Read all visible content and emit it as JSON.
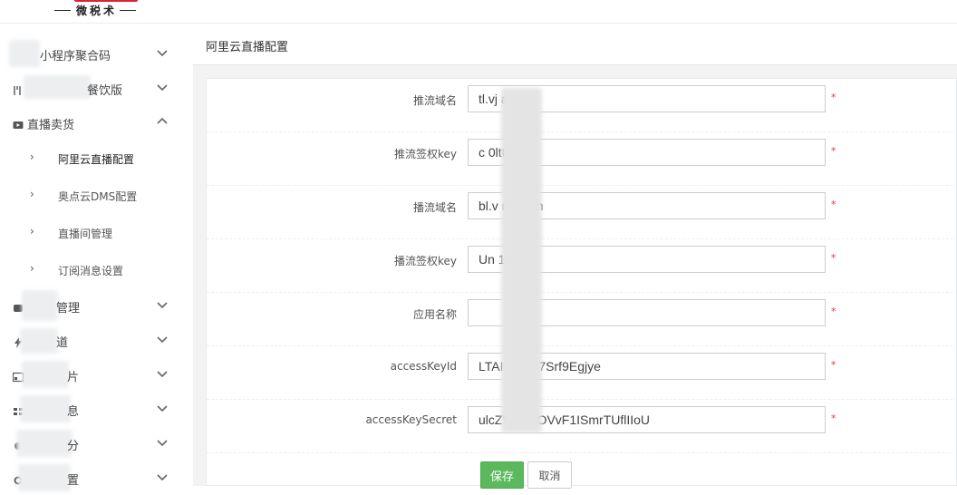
{
  "header": {
    "logo_text": "微税术"
  },
  "sidebar": {
    "items": [
      {
        "label": "小程序聚合码",
        "icon": "qrcode-icon",
        "expanded": false
      },
      {
        "label": "餐饮版",
        "icon": "utensils-icon",
        "expanded": false
      },
      {
        "label": "直播卖货",
        "icon": "video-icon",
        "expanded": true
      },
      {
        "label": "管理",
        "icon": "box-icon",
        "expanded": false
      },
      {
        "label": "道",
        "icon": "lightning-icon",
        "expanded": false
      },
      {
        "label": "片",
        "icon": "image-icon",
        "expanded": false
      },
      {
        "label": "息",
        "icon": "grid-icon",
        "expanded": false
      },
      {
        "label": "分",
        "icon": "coin-icon",
        "expanded": false
      },
      {
        "label": "置",
        "icon": "gear-icon",
        "expanded": false
      }
    ],
    "subitems": [
      {
        "label": "阿里云直播配置",
        "active": true
      },
      {
        "label": "奥点云DMS配置",
        "active": false
      },
      {
        "label": "直播间管理",
        "active": false
      },
      {
        "label": "订阅消息设置",
        "active": false
      }
    ]
  },
  "main": {
    "title": "阿里云直播配置",
    "fields": [
      {
        "label": "推流域名",
        "value": "tl.vj          a.com"
      },
      {
        "label": "推流签权key",
        "value": "c             0ltKx"
      },
      {
        "label": "播流域名",
        "value": "bl.v           na.com"
      },
      {
        "label": "播流签权key",
        "value": "Un            1NPf"
      },
      {
        "label": "应用名称",
        "value": ""
      },
      {
        "label": "accessKeyId",
        "value": "LTAI              ZXpK7Srf9Egjye"
      },
      {
        "label": "accessKeySecret",
        "value": "ulcZVxiye              OVvF1ISmrTUflIIoU"
      }
    ],
    "required_mark": "*",
    "save_label": "保存",
    "cancel_label": "取消"
  },
  "colors": {
    "accent": "#5cb85c",
    "required": "#e33333"
  }
}
